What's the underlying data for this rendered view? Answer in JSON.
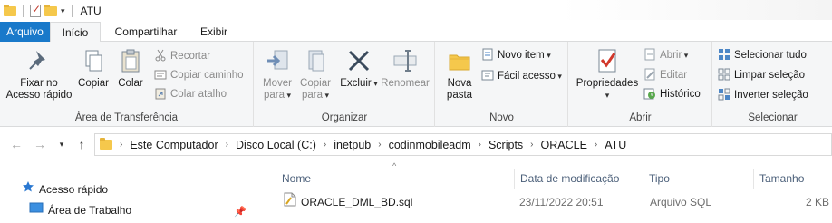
{
  "title_bar": {
    "title": "ATU"
  },
  "tabs": [
    {
      "label": "Arquivo"
    },
    {
      "label": "Início"
    },
    {
      "label": "Compartilhar"
    },
    {
      "label": "Exibir"
    }
  ],
  "ribbon": {
    "clipboard": {
      "label": "Área de Transferência",
      "pin_line1": "Fixar no",
      "pin_line2": "Acesso rápido",
      "copy": "Copiar",
      "paste": "Colar",
      "cut": "Recortar",
      "copy_path": "Copiar caminho",
      "paste_shortcut": "Colar atalho"
    },
    "organize": {
      "label": "Organizar",
      "move_line1": "Mover",
      "move_line2": "para",
      "copy_line1": "Copiar",
      "copy_line2": "para",
      "delete": "Excluir",
      "rename": "Renomear"
    },
    "new": {
      "label": "Novo",
      "new_folder_line1": "Nova",
      "new_folder_line2": "pasta",
      "new_item": "Novo item",
      "easy_access": "Fácil acesso"
    },
    "open": {
      "label": "Abrir",
      "properties": "Propriedades",
      "open": "Abrir",
      "edit": "Editar",
      "history": "Histórico"
    },
    "select": {
      "label": "Selecionar",
      "select_all": "Selecionar tudo",
      "select_none": "Limpar seleção",
      "invert": "Inverter seleção"
    }
  },
  "address": {
    "breadcrumbs": [
      "Este Computador",
      "Disco Local (C:)",
      "inetpub",
      "codinmobileadm",
      "Scripts",
      "ORACLE",
      "ATU"
    ]
  },
  "nav_pane": {
    "quick_access": "Acesso rápido",
    "desktop": "Área de Trabalho"
  },
  "list": {
    "columns": [
      "Nome",
      "Data de modificação",
      "Tipo",
      "Tamanho"
    ],
    "rows": [
      {
        "name": "ORACLE_DML_BD.sql",
        "modified": "23/11/2022 20:51",
        "type": "Arquivo SQL",
        "size": "2 KB"
      }
    ]
  },
  "colors": {
    "file_tab": "#1979ca",
    "folder": "#f5c84c",
    "ribbon_bg": "#f5f6f7"
  },
  "icons": [
    "folder-icon",
    "properties-icon",
    "pin-icon",
    "copy-icon",
    "paste-icon",
    "cut-icon",
    "move-icon",
    "delete-icon",
    "rename-icon",
    "new-folder-icon",
    "star-icon",
    "desktop-icon",
    "sql-file-icon"
  ]
}
